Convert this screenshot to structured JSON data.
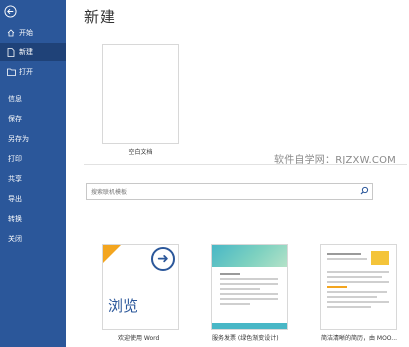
{
  "sidebar": {
    "items": [
      {
        "label": "开始",
        "icon": "home-icon"
      },
      {
        "label": "新建",
        "icon": "new-document-icon",
        "active": true
      },
      {
        "label": "打开",
        "icon": "folder-icon"
      },
      {
        "label": "信息"
      },
      {
        "label": "保存"
      },
      {
        "label": "另存为"
      },
      {
        "label": "打印"
      },
      {
        "label": "共享"
      },
      {
        "label": "导出"
      },
      {
        "label": "转换"
      },
      {
        "label": "关闭"
      }
    ]
  },
  "main": {
    "title": "新建",
    "blank_label": "空白文档",
    "watermark": "软件自学网：RJZXW.COM",
    "search_placeholder": "搜索联机模板",
    "templates": [
      {
        "label": "欢迎使用 Word",
        "thumb_text": "浏览"
      },
      {
        "label": "服务发票 (绿色渐变设计)"
      },
      {
        "label": "简洁清晰的简历，由 MOO..."
      }
    ]
  },
  "colors": {
    "sidebar": "#2b579a",
    "accent_orange": "#f3a51f",
    "teal": "#48b7c6"
  }
}
